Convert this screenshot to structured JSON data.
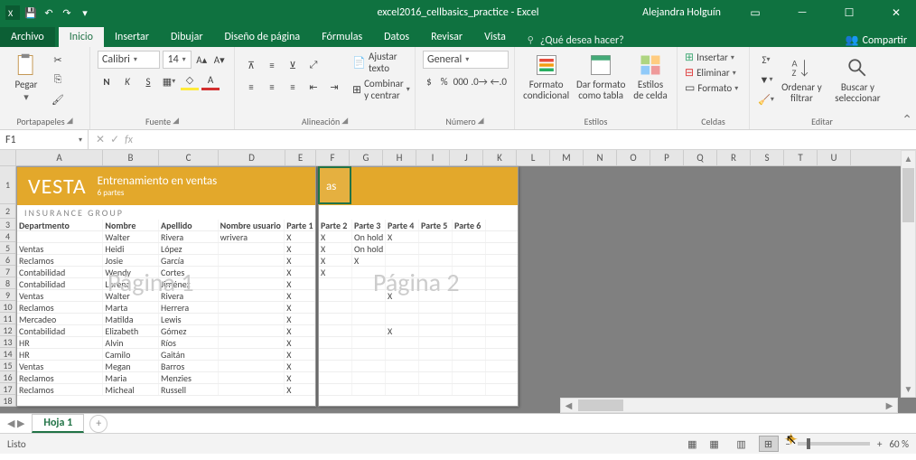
{
  "titlebar": {
    "title": "excel2016_cellbasics_practice - Excel",
    "user": "Alejandra Holguín"
  },
  "tabs": {
    "file": "Archivo",
    "list": [
      "Inicio",
      "Insertar",
      "Dibujar",
      "Diseño de página",
      "Fórmulas",
      "Datos",
      "Revisar",
      "Vista"
    ],
    "tell": "¿Qué desea hacer?",
    "share": "Compartir"
  },
  "ribbon": {
    "clipboard": {
      "label": "Portapapeles",
      "paste": "Pegar"
    },
    "font": {
      "label": "Fuente",
      "name": "Calibri",
      "size": "14",
      "bold": "N",
      "italic": "K",
      "underline": "S"
    },
    "align": {
      "label": "Alineación",
      "wrap": "Ajustar texto",
      "merge": "Combinar y centrar"
    },
    "number": {
      "label": "Número",
      "format": "General"
    },
    "styles": {
      "label": "Estilos",
      "cond": "Formato condicional",
      "table": "Dar formato como tabla",
      "cell": "Estilos de celda"
    },
    "cells": {
      "label": "Celdas",
      "insert": "Insertar",
      "delete": "Eliminar",
      "format": "Formato"
    },
    "edit": {
      "label": "Editar",
      "sort": "Ordenar y filtrar",
      "find": "Buscar y seleccionar"
    }
  },
  "namebox": "F1",
  "banner": {
    "logo": "VESTA",
    "title": "Entrenamiento en ventas",
    "sub": "6 partes",
    "insurance": "INSURANCE  GROUP"
  },
  "watermarks": {
    "p1": "Página 1",
    "p2": "Página 2"
  },
  "headers": [
    "Departmento",
    "Nombre",
    "Apellido",
    "Nombre usuario",
    "Parte 1",
    "Parte 2",
    "Parte 3",
    "Parte 4",
    "Parte 5",
    "Parte 6"
  ],
  "rows": [
    [
      "",
      "Walter",
      "Rivera",
      "wrivera",
      "X",
      "X",
      "On hold",
      "X",
      "",
      ""
    ],
    [
      "Ventas",
      "Heidi",
      "López",
      "",
      "X",
      "X",
      "On hold",
      "",
      "",
      ""
    ],
    [
      "Reclamos",
      "Josie",
      "García",
      "",
      "X",
      "X",
      "X",
      "",
      "",
      ""
    ],
    [
      "Contabilidad",
      "Wendy",
      "Cortes",
      "",
      "X",
      "X",
      "",
      "",
      "",
      ""
    ],
    [
      "Contabilidad",
      "Lorena",
      "Jiménez",
      "",
      "X",
      "",
      "",
      "",
      "",
      ""
    ],
    [
      "Ventas",
      "Walter",
      "Rivera",
      "",
      "X",
      "",
      "",
      "X",
      "",
      ""
    ],
    [
      "Reclamos",
      "Marta",
      "Herrera",
      "",
      "X",
      "",
      "",
      "",
      "",
      ""
    ],
    [
      "Mercadeo",
      "Matilda",
      "Lewis",
      "",
      "X",
      "",
      "",
      "",
      "",
      ""
    ],
    [
      "Contabilidad",
      "Elizabeth",
      "Gómez",
      "",
      "X",
      "",
      "",
      "X",
      "",
      ""
    ],
    [
      "HR",
      "Alvin",
      "Ríos",
      "",
      "X",
      "",
      "",
      "",
      "",
      ""
    ],
    [
      "HR",
      "Camilo",
      "Gaitán",
      "",
      "X",
      "",
      "",
      "",
      "",
      ""
    ],
    [
      "Ventas",
      "Megan",
      "Barros",
      "",
      "X",
      "",
      "",
      "",
      "",
      ""
    ],
    [
      "Reclamos",
      "Maria",
      "Menzies",
      "",
      "X",
      "",
      "",
      "",
      "",
      ""
    ],
    [
      "Reclamos",
      "Micheal",
      "Russell",
      "",
      "X",
      "",
      "",
      "",
      "",
      ""
    ]
  ],
  "sheettab": "Hoja 1",
  "status": {
    "ready": "Listo",
    "zoom": "60 %"
  },
  "chart_data": null
}
